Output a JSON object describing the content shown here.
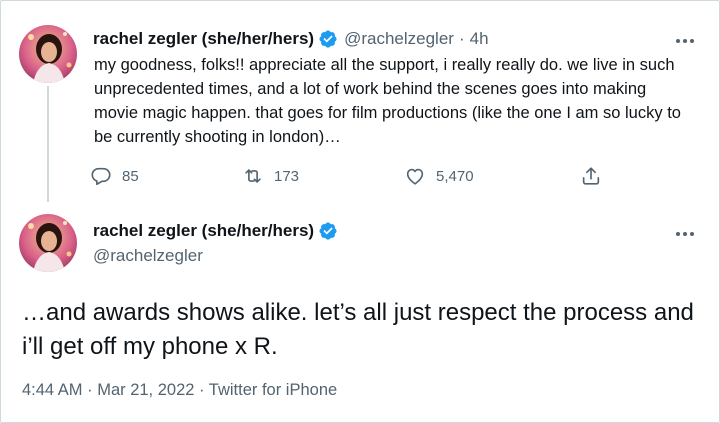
{
  "tweet1": {
    "author_name": "rachel zegler (she/her/hers)",
    "handle": "@rachelzegler",
    "separator": "·",
    "time": "4h",
    "text": "my goodness, folks!! appreciate all the support, i really really do. we live in such unprecedented times, and a lot of work behind the scenes goes into making movie magic happen. that goes for film productions (like the one I am so lucky to be currently shooting in london)…",
    "replies": "85",
    "retweets": "173",
    "likes": "5,470"
  },
  "tweet2": {
    "author_name": "rachel zegler (she/her/hers)",
    "handle": "@rachelzegler",
    "text": "…and awards shows alike. let’s all just respect the process and i’ll get off my phone x R.",
    "timestamp": "4:44 AM · Mar 21, 2022 · Twitter for iPhone"
  },
  "icons": {
    "verified": "verified-badge-icon",
    "more": "more-horizontal-icon",
    "reply": "reply-bubble-icon",
    "retweet": "retweet-icon",
    "like": "heart-icon",
    "share": "share-icon"
  },
  "colors": {
    "verified_blue": "#1d9bf0",
    "secondary_text": "#536471",
    "primary_text": "#0f1419",
    "avatar_accent": "#d44a7c"
  }
}
